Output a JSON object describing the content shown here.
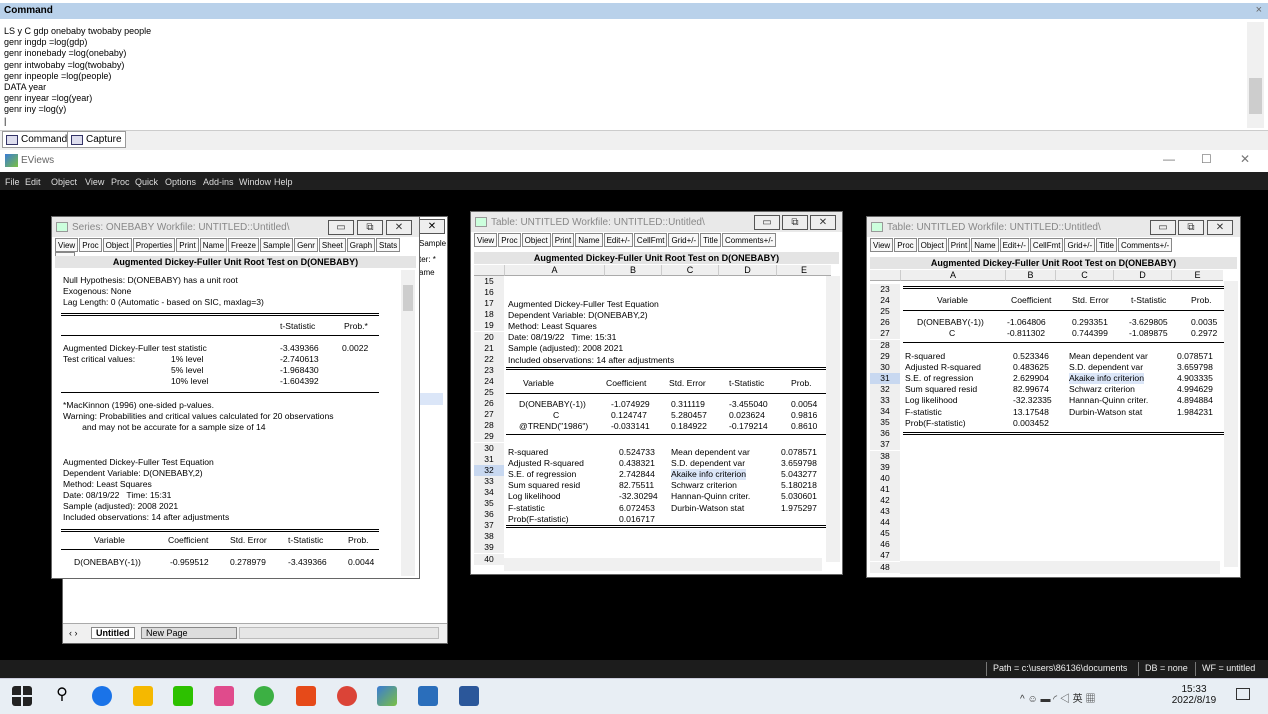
{
  "command_window": {
    "title": "Command",
    "close": "×",
    "lines": [
      "LS y C gdp onebaby twobaby people",
      "genr ingdp =log(gdp)",
      "genr inonebady =log(onebaby)",
      "genr intwobaby =log(twobaby)",
      "genr inpeople =log(people)",
      "DATA year",
      "genr inyear =log(year)",
      "genr iny =log(y)",
      "|"
    ],
    "tabs": [
      "Command",
      "Capture"
    ]
  },
  "app": {
    "title": "EViews",
    "menu": [
      "File",
      "Edit",
      "Object",
      "View",
      "Proc",
      "Quick",
      "Options",
      "Add-ins",
      "Window",
      "Help"
    ],
    "min": "—",
    "max": "☐",
    "close": "✕"
  },
  "series_win": {
    "title": "Series: ONEBABY   Workfile: UNTITLED::Untitled\\",
    "toolbar": [
      "View",
      "Proc",
      "Object",
      "Properties",
      "Print",
      "Name",
      "Freeze",
      "Sample",
      "Genr",
      "Sheet",
      "Graph",
      "Stats",
      "Ider"
    ],
    "header": "Augmented Dickey-Fuller Unit Root Test on D(ONEBABY)",
    "lines": [
      "Null Hypothesis: D(ONEBABY) has a unit root",
      "Exogenous: None",
      "Lag Length: 0 (Automatic - based on SIC, maxlag=3)"
    ],
    "colhdr": [
      "t-Statistic",
      "Prob.*"
    ],
    "adf": {
      "label": "Augmented Dickey-Fuller test statistic",
      "t": "-3.439366",
      "p": "0.0022"
    },
    "crit_label": "Test critical values:",
    "crit": [
      {
        "l": "1% level",
        "v": "-2.740613"
      },
      {
        "l": "5% level",
        "v": "-1.968430"
      },
      {
        "l": "10% level",
        "v": "-1.604392"
      }
    ],
    "notes": [
      "*MacKinnon (1996) one-sided p-values.",
      "Warning: Probabilities and critical values calculated for 20 observations",
      "        and may not be accurate for a sample size of 14"
    ],
    "eq": [
      "Augmented Dickey-Fuller Test Equation",
      "Dependent Variable: D(ONEBABY,2)",
      "Method: Least Squares",
      "Date: 08/19/22   Time: 15:31",
      "Sample (adjusted): 2008 2021",
      "Included observations: 14 after adjustments"
    ],
    "cols": [
      "Variable",
      "Coefficient",
      "Std. Error",
      "t-Statistic",
      "Prob."
    ],
    "row": [
      "D(ONEBABY(-1))",
      "-0.959512",
      "0.278979",
      "-3.439366",
      "0.0044"
    ]
  },
  "workfile_back": {
    "sample_label": "Sample",
    "filter_label": "ter: *",
    "name_label": "ame",
    "tabs": [
      "Untitled",
      "New Page"
    ]
  },
  "table2": {
    "title": "Table: UNTITLED   Workfile: UNTITLED::Untitled\\",
    "toolbar": [
      "View",
      "Proc",
      "Object",
      "Print",
      "Name",
      "Edit+/-",
      "CellFmt",
      "Grid+/-",
      "Title",
      "Comments+/-"
    ],
    "header": "Augmented Dickey-Fuller Unit Root Test on D(ONEBABY)",
    "cols": [
      "A",
      "B",
      "C",
      "D",
      "E"
    ],
    "rows": [
      "15",
      "16",
      "17",
      "18",
      "19",
      "20",
      "21",
      "22",
      "23",
      "24",
      "25",
      "26",
      "27",
      "28",
      "29",
      "30",
      "31",
      "32",
      "33",
      "34",
      "35",
      "36",
      "37",
      "38",
      "39",
      "40"
    ],
    "info": [
      "Augmented Dickey-Fuller Test Equation",
      "Dependent Variable: D(ONEBABY,2)",
      "Method: Least Squares",
      "Date: 08/19/22   Time: 15:31",
      "Sample (adjusted): 2008 2021",
      "Included observations: 14 after adjustments"
    ],
    "vcols": [
      "Variable",
      "Coefficient",
      "Std. Error",
      "t-Statistic",
      "Prob."
    ],
    "vars": [
      [
        "D(ONEBABY(-1))",
        "-1.074929",
        "0.311119",
        "-3.455040",
        "0.0054"
      ],
      [
        "C",
        "0.124747",
        "5.280457",
        "0.023624",
        "0.9816"
      ],
      [
        "@TREND(\"1986\")",
        "-0.033141",
        "0.184922",
        "-0.179214",
        "0.8610"
      ]
    ],
    "stats": [
      [
        "R-squared",
        "0.524733",
        "Mean dependent var",
        "0.078571"
      ],
      [
        "Adjusted R-squared",
        "0.438321",
        "S.D. dependent var",
        "3.659798"
      ],
      [
        "S.E. of regression",
        "2.742844",
        "Akaike info criterion",
        "5.043277"
      ],
      [
        "Sum squared resid",
        "82.75511",
        "Schwarz criterion",
        "5.180218"
      ],
      [
        "Log likelihood",
        "-32.30294",
        "Hannan-Quinn criter.",
        "5.030601"
      ],
      [
        "F-statistic",
        "6.072453",
        "Durbin-Watson stat",
        "1.975297"
      ],
      [
        "Prob(F-statistic)",
        "0.016717",
        "",
        ""
      ]
    ]
  },
  "table3": {
    "title": "Table: UNTITLED   Workfile: UNTITLED::Untitled\\",
    "toolbar": [
      "View",
      "Proc",
      "Object",
      "Print",
      "Name",
      "Edit+/-",
      "CellFmt",
      "Grid+/-",
      "Title",
      "Comments+/-"
    ],
    "header": "Augmented Dickey-Fuller Unit Root Test on D(ONEBABY)",
    "cols": [
      "A",
      "B",
      "C",
      "D",
      "E"
    ],
    "rows": [
      "23",
      "24",
      "25",
      "26",
      "27",
      "28",
      "29",
      "30",
      "31",
      "32",
      "33",
      "34",
      "35",
      "36",
      "37",
      "38",
      "39",
      "40",
      "41",
      "42",
      "43",
      "44",
      "45",
      "46",
      "47",
      "48"
    ],
    "vcols": [
      "Variable",
      "Coefficient",
      "Std. Error",
      "t-Statistic",
      "Prob."
    ],
    "vars": [
      [
        "D(ONEBABY(-1))",
        "-1.064806",
        "0.293351",
        "-3.629805",
        "0.0035"
      ],
      [
        "C",
        "-0.811302",
        "0.744399",
        "-1.089875",
        "0.2972"
      ]
    ],
    "stats": [
      [
        "R-squared",
        "0.523346",
        "Mean dependent var",
        "0.078571"
      ],
      [
        "Adjusted R-squared",
        "0.483625",
        "S.D. dependent var",
        "3.659798"
      ],
      [
        "S.E. of regression",
        "2.629904",
        "Akaike info criterion",
        "4.903335"
      ],
      [
        "Sum squared resid",
        "82.99674",
        "Schwarz criterion",
        "4.994629"
      ],
      [
        "Log likelihood",
        "-32.32335",
        "Hannan-Quinn criter.",
        "4.894884"
      ],
      [
        "F-statistic",
        "13.17548",
        "Durbin-Watson stat",
        "1.984231"
      ],
      [
        "Prob(F-statistic)",
        "0.003452",
        "",
        ""
      ]
    ]
  },
  "status": {
    "path": "Path = c:\\users\\86136\\documents",
    "db": "DB = none",
    "wf": "WF = untitled"
  },
  "taskbar": {
    "time": "15:33",
    "date": "2022/8/19",
    "ime": "英"
  }
}
